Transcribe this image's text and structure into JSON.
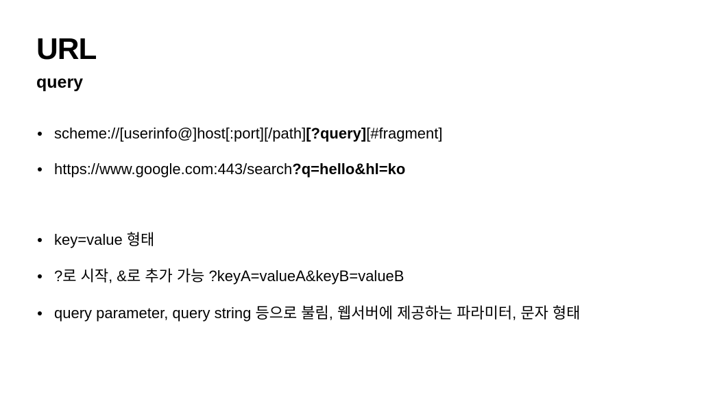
{
  "slide": {
    "title": "URL",
    "subtitle": "query",
    "bullets": [
      {
        "parts": [
          {
            "text": "scheme://[userinfo@]host[:port][/path]",
            "bold": false
          },
          {
            "text": "[?query]",
            "bold": true
          },
          {
            "text": "[#fragment]",
            "bold": false
          }
        ]
      },
      {
        "parts": [
          {
            "text": "https://www.google.com:443/search",
            "bold": false
          },
          {
            "text": "?q=hello&hl=ko",
            "bold": true
          }
        ]
      },
      {
        "parts": [
          {
            "text": "key=value 형태",
            "bold": false
          }
        ]
      },
      {
        "parts": [
          {
            "text": "?로 시작, &로 추가 가능 ?keyA=valueA&keyB=valueB",
            "bold": false
          }
        ]
      },
      {
        "parts": [
          {
            "text": "query parameter, query string 등으로 불림, 웹서버에 제공하는 파라미터, 문자 형태",
            "bold": false
          }
        ]
      }
    ]
  }
}
